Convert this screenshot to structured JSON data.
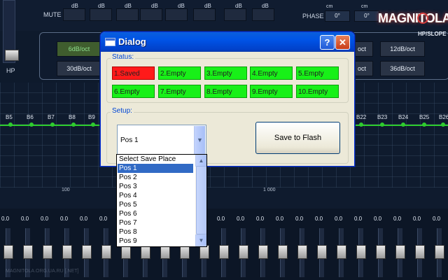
{
  "app": {
    "hp_label": "HP",
    "mute_label": "MUTE",
    "phase_label": "PHASE",
    "db_unit": "dB",
    "cm_unit": "cm",
    "phase_values": [
      "0°",
      "0°"
    ],
    "logo_text": "MAGNITOLA",
    "hp_slope_label": "HP/SLOPE",
    "slope_buttons_left": [
      "6dB/oct",
      "30dB/oct"
    ],
    "slope_buttons_right_top": [
      "oct",
      "12dB/oct"
    ],
    "slope_buttons_right_bottom": [
      "oct",
      "36dB/oct"
    ],
    "bands_left": [
      "B5",
      "B6",
      "B7",
      "B8",
      "B9"
    ],
    "bands_right": [
      "B22",
      "B23",
      "B24",
      "B25",
      "B26"
    ],
    "freq_labels": [
      "100",
      "1 000"
    ],
    "slider_value": "0.0",
    "watermark": "MAGNITOLA.ORG.UA.RU [.NET]"
  },
  "dialog": {
    "title": "Dialog",
    "help_label": "?",
    "close_label": "✕",
    "status_title": "Status:",
    "setup_title": "Setup:",
    "slots": [
      {
        "label": "1.Saved",
        "state": "saved",
        "color": "#ff1a1a"
      },
      {
        "label": "2.Empty",
        "state": "empty",
        "color": "#18f018"
      },
      {
        "label": "3.Empty",
        "state": "empty",
        "color": "#18f018"
      },
      {
        "label": "4.Empty",
        "state": "empty",
        "color": "#18f018"
      },
      {
        "label": "5.Empty",
        "state": "empty",
        "color": "#18f018"
      },
      {
        "label": "6.Empty",
        "state": "empty",
        "color": "#18f018"
      },
      {
        "label": "7.Empty",
        "state": "empty",
        "color": "#18f018"
      },
      {
        "label": "8.Empty",
        "state": "empty",
        "color": "#18f018"
      },
      {
        "label": "9.Empty",
        "state": "empty",
        "color": "#18f018"
      },
      {
        "label": "10.Empty",
        "state": "empty",
        "color": "#18f018"
      }
    ],
    "select_value": "Pos 1",
    "save_button_label": "Save to Flash",
    "dropdown_options": [
      "Select Save Place",
      "Pos 1",
      "Pos 2",
      "Pos 3",
      "Pos 4",
      "Pos 5",
      "Pos 6",
      "Pos 7",
      "Pos 8",
      "Pos 9"
    ],
    "dropdown_selected": "Pos 1"
  }
}
